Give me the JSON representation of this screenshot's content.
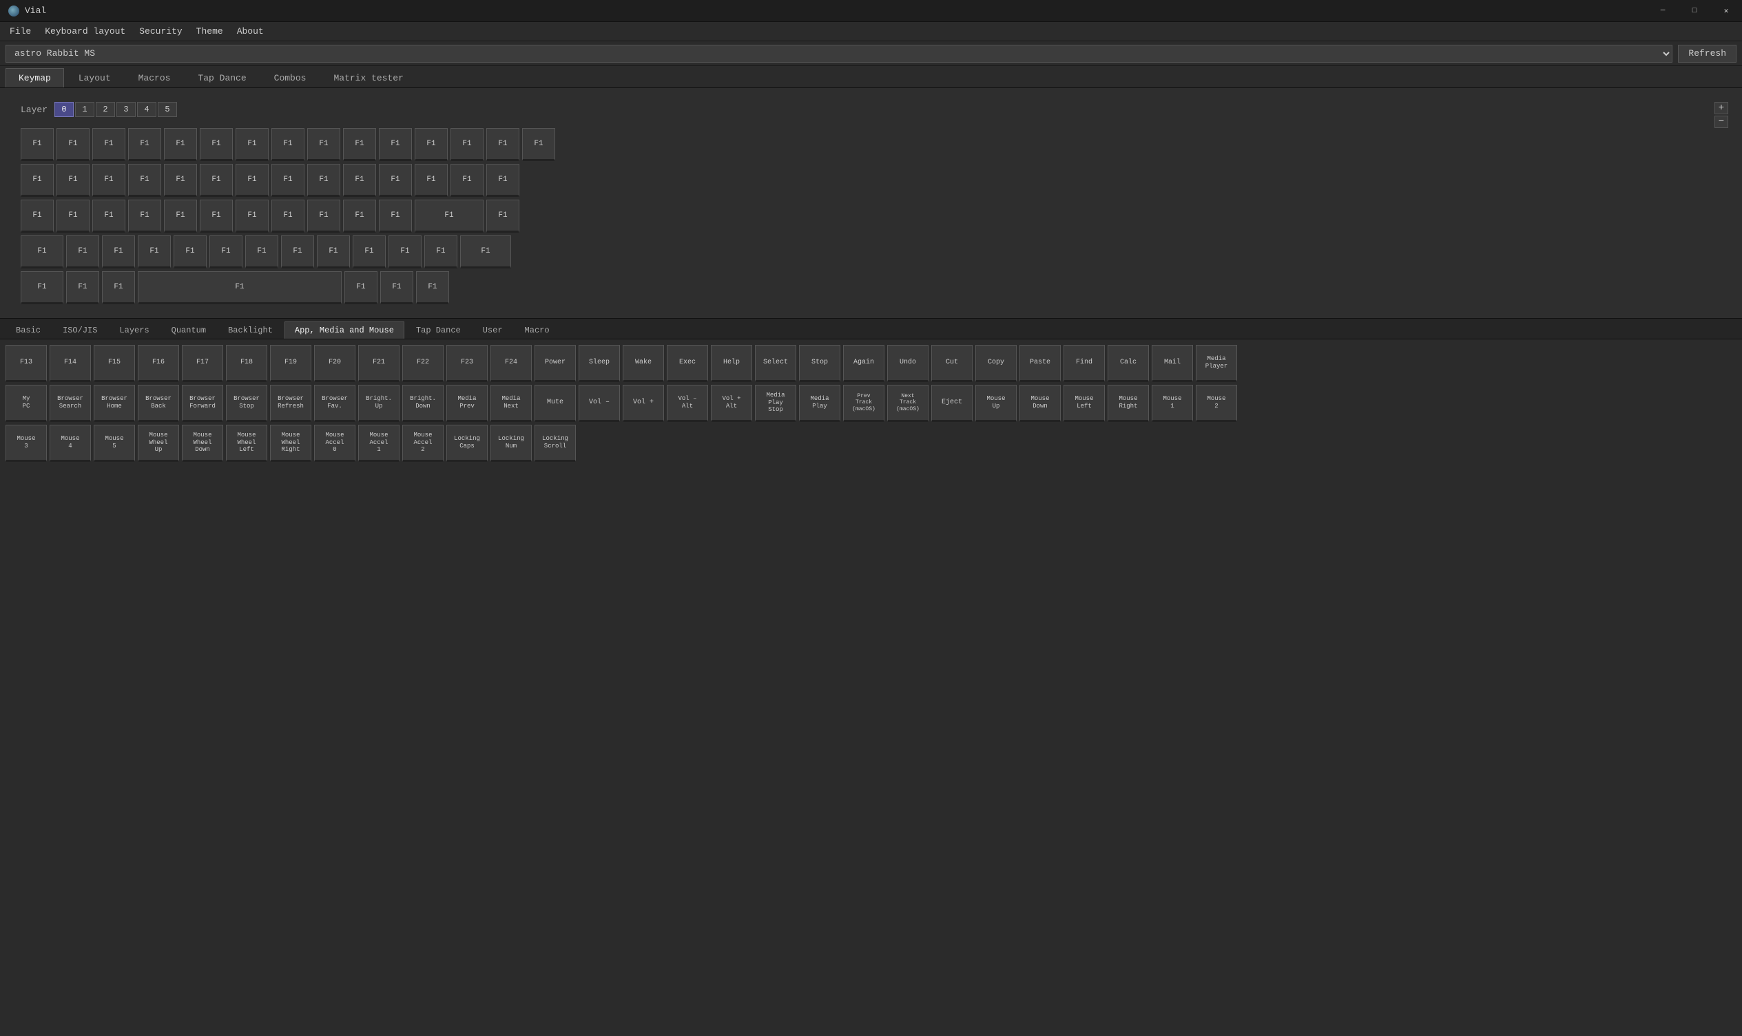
{
  "titleBar": {
    "title": "Vial"
  },
  "windowControls": {
    "minimize": "─",
    "maximize": "□",
    "close": "✕"
  },
  "menuBar": {
    "items": [
      "File",
      "Keyboard layout",
      "Security",
      "Theme",
      "About"
    ]
  },
  "deviceBar": {
    "deviceName": "astro Rabbit MS",
    "refreshLabel": "Refresh"
  },
  "tabs": [
    {
      "label": "Keymap",
      "active": true
    },
    {
      "label": "Layout",
      "active": false
    },
    {
      "label": "Macros",
      "active": false
    },
    {
      "label": "Tap Dance",
      "active": false
    },
    {
      "label": "Combos",
      "active": false
    },
    {
      "label": "Matrix tester",
      "active": false
    }
  ],
  "layers": {
    "label": "Layer",
    "buttons": [
      "0",
      "1",
      "2",
      "3",
      "4",
      "5"
    ],
    "active": 0,
    "plus": "+",
    "minus": "−"
  },
  "keyboard": {
    "rows": [
      [
        "F1",
        "F1",
        "F1",
        "F1",
        "F1",
        "F1",
        "F1",
        "F1",
        "F1",
        "F1",
        "F1",
        "F1",
        "F1",
        "F1",
        "F1"
      ],
      [
        "F1",
        "F1",
        "F1",
        "F1",
        "F1",
        "F1",
        "F1",
        "F1",
        "F1",
        "F1",
        "F1",
        "F1",
        "F1",
        "F1"
      ],
      [
        "F1",
        "F1",
        "F1",
        "F1",
        "F1",
        "F1",
        "F1",
        "F1",
        "F1",
        "F1",
        "F1",
        "",
        "F1"
      ],
      [
        "F1",
        "F1",
        "F1",
        "F1",
        "F1",
        "F1",
        "F1",
        "F1",
        "F1",
        "F1",
        "F1",
        "F1",
        "F1"
      ],
      [
        "F1",
        "F1",
        "F1",
        "",
        "F1",
        "",
        "F1",
        "F1",
        "F1"
      ]
    ]
  },
  "categoryTabs": [
    {
      "label": "Basic",
      "active": false
    },
    {
      "label": "ISO/JIS",
      "active": false
    },
    {
      "label": "Layers",
      "active": false
    },
    {
      "label": "Quantum",
      "active": false
    },
    {
      "label": "Backlight",
      "active": false
    },
    {
      "label": "App, Media and Mouse",
      "active": true
    },
    {
      "label": "Tap Dance",
      "active": false
    },
    {
      "label": "User",
      "active": false
    },
    {
      "label": "Macro",
      "active": false
    }
  ],
  "gridRows": [
    [
      {
        "label": "F13"
      },
      {
        "label": "F14"
      },
      {
        "label": "F15"
      },
      {
        "label": "F16"
      },
      {
        "label": "F17"
      },
      {
        "label": "F18"
      },
      {
        "label": "F19"
      },
      {
        "label": "F20"
      },
      {
        "label": "F21"
      },
      {
        "label": "F22"
      },
      {
        "label": "F23"
      },
      {
        "label": "F24"
      },
      {
        "label": "Power"
      },
      {
        "label": "Sleep"
      },
      {
        "label": "Wake"
      },
      {
        "label": "Exec"
      },
      {
        "label": "Help"
      },
      {
        "label": "Select"
      },
      {
        "label": "Stop"
      },
      {
        "label": "Again"
      },
      {
        "label": "Undo"
      },
      {
        "label": "Cut"
      },
      {
        "label": "Copy"
      },
      {
        "label": "Paste"
      },
      {
        "label": "Find"
      },
      {
        "label": "Calc"
      },
      {
        "label": "Mail"
      },
      {
        "label": "Media\nPlayer"
      }
    ],
    [
      {
        "label": "My\nPC"
      },
      {
        "label": "Browser\nSearch"
      },
      {
        "label": "Browser\nHome"
      },
      {
        "label": "Browser\nBack"
      },
      {
        "label": "Browser\nForward"
      },
      {
        "label": "Browser\nStop"
      },
      {
        "label": "Browser\nRefresh"
      },
      {
        "label": "Browser\nFav."
      },
      {
        "label": "Bright.\nUp"
      },
      {
        "label": "Bright.\nDown"
      },
      {
        "label": "Media\nPrev"
      },
      {
        "label": "Media\nNext"
      },
      {
        "label": "Mute"
      },
      {
        "label": "Vol –"
      },
      {
        "label": "Vol +"
      },
      {
        "label": "Vol –\nAlt"
      },
      {
        "label": "Vol +\nAlt"
      },
      {
        "label": "Media\nPlay\nStop"
      },
      {
        "label": "Media\nPlay"
      },
      {
        "label": "Prev\nTrack\n(macOS)"
      },
      {
        "label": "Next\nTrack\n(macOS)"
      },
      {
        "label": "Eject"
      },
      {
        "label": "Mouse\nUp"
      },
      {
        "label": "Mouse\nDown"
      },
      {
        "label": "Mouse\nLeft"
      },
      {
        "label": "Mouse\nRight"
      },
      {
        "label": "Mouse\n1"
      },
      {
        "label": "Mouse\n2"
      }
    ],
    [
      {
        "label": "Mouse\n3"
      },
      {
        "label": "Mouse\n4"
      },
      {
        "label": "Mouse\n5"
      },
      {
        "label": "Mouse\nWheel\nUp"
      },
      {
        "label": "Mouse\nWheel\nDown"
      },
      {
        "label": "Mouse\nWheel\nLeft"
      },
      {
        "label": "Mouse\nWheel\nRight"
      },
      {
        "label": "Mouse\nAccel\n0"
      },
      {
        "label": "Mouse\nAccel\n1"
      },
      {
        "label": "Mouse\nAccel\n2"
      },
      {
        "label": "Locking\nCaps"
      },
      {
        "label": "Locking\nNum"
      },
      {
        "label": "Locking\nScroll"
      }
    ]
  ]
}
